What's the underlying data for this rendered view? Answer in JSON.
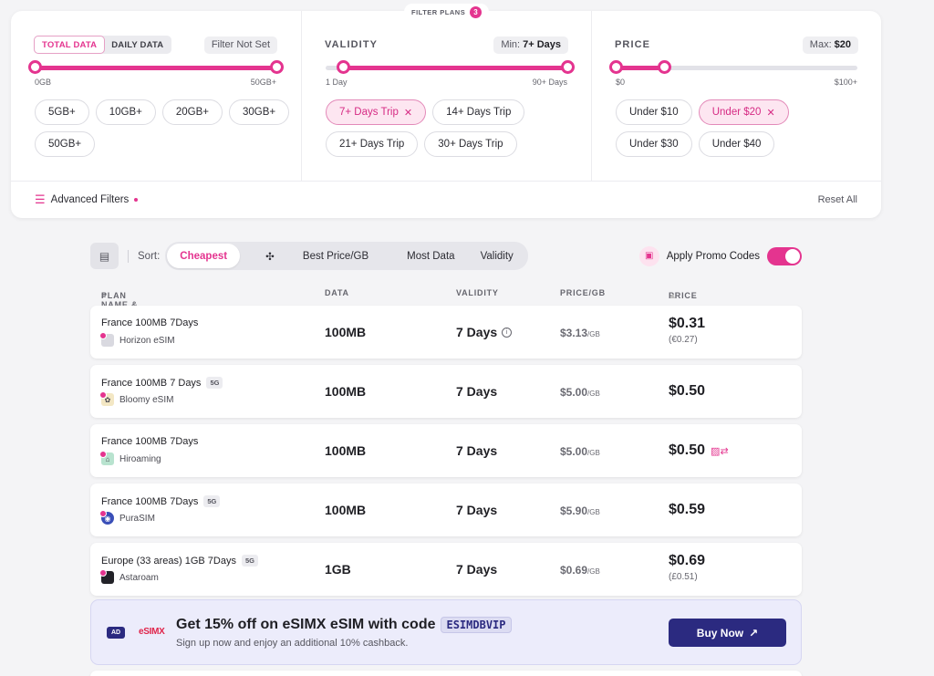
{
  "filters": {
    "badge_label": "FILTER PLANS",
    "badge_count": "3",
    "data": {
      "seg_total": "TOTAL DATA",
      "seg_daily": "DAILY DATA",
      "status": "Filter Not Set",
      "min_label": "0GB",
      "max_label": "50GB+",
      "range_low_fraction": 0,
      "range_high_fraction": 1,
      "chips": [
        "5GB+",
        "10GB+",
        "20GB+",
        "30GB+",
        "50GB+"
      ]
    },
    "validity": {
      "title": "VALIDITY",
      "min_prefix": "Min:",
      "min_value": "7+ Days",
      "min_label": "1 Day",
      "max_label": "90+ Days",
      "range_low_fraction": 0.07,
      "range_high_fraction": 1,
      "chips": [
        "7+ Days Trip",
        "14+ Days Trip",
        "21+ Days Trip",
        "30+ Days Trip"
      ],
      "active_chip": "7+ Days Trip"
    },
    "price": {
      "title": "PRICE",
      "max_prefix": "Max:",
      "max_value": "$20",
      "min_label": "$0",
      "max_label": "$100+",
      "range_low_fraction": 0,
      "range_high_fraction": 0.2,
      "chips": [
        "Under $10",
        "Under $20",
        "Under $30",
        "Under $40"
      ],
      "active_chip": "Under $20"
    },
    "advanced": "Advanced Filters",
    "reset": "Reset All"
  },
  "sort": {
    "label": "Sort:",
    "tabs": [
      "Cheapest",
      "Best Price/GB",
      "Most Data",
      "Validity"
    ],
    "active": "Cheapest",
    "promo_label": "Apply Promo Codes",
    "promo_on": true
  },
  "table": {
    "headers": {
      "plan": "PLAN NAME & PROVIDER",
      "data": "DATA",
      "validity": "VALIDITY",
      "price_gb": "PRICE/GB",
      "price": "PRICE"
    },
    "rows": [
      {
        "name": "France 100MB 7Days",
        "tag": "",
        "provider": "Horizon eSIM",
        "data": "100MB",
        "validity": "7 Days",
        "price_gb": "$3.13",
        "per_unit": "/GB",
        "price": "$0.31",
        "converted": "(€0.27)",
        "logo_color": "#d9d9e0",
        "info": true,
        "cashback": false
      },
      {
        "name": "France 100MB 7 Days",
        "tag": "5G",
        "provider": "Bloomy eSIM",
        "data": "100MB",
        "validity": "7 Days",
        "price_gb": "$5.00",
        "per_unit": "/GB",
        "price": "$0.50",
        "converted": "",
        "logo_color": "#f3e7c4",
        "info": false,
        "cashback": false
      },
      {
        "name": "France 100MB 7Days",
        "tag": "",
        "provider": "Hiroaming",
        "data": "100MB",
        "validity": "7 Days",
        "price_gb": "$5.00",
        "per_unit": "/GB",
        "price": "$0.50",
        "converted": "",
        "logo_color": "#b8e3cf",
        "info": false,
        "cashback": true
      },
      {
        "name": "France 100MB 7Days",
        "tag": "5G",
        "provider": "PuraSIM",
        "data": "100MB",
        "validity": "7 Days",
        "price_gb": "$5.90",
        "per_unit": "/GB",
        "price": "$0.59",
        "converted": "",
        "logo_color": "#3a4fb8",
        "info": false,
        "cashback": false
      },
      {
        "name": "Europe (33 areas) 1GB 7Days",
        "tag": "5G",
        "provider": "Astaroam",
        "data": "1GB",
        "validity": "7 Days",
        "price_gb": "$0.69",
        "per_unit": "/GB",
        "price": "$0.69",
        "converted": "(£0.51)",
        "logo_color": "#222228",
        "info": false,
        "cashback": false
      }
    ]
  },
  "ad": {
    "label": "AD",
    "brand": "eSIMX",
    "title": "Get 15% off on eSIMX eSIM with code",
    "code": "ESIMDBVIP",
    "subtitle": "Sign up now and enjoy an additional 10% cashback.",
    "button": "Buy Now"
  },
  "colors": {
    "accent": "#e4348f",
    "ad_button": "#2b2a80"
  }
}
